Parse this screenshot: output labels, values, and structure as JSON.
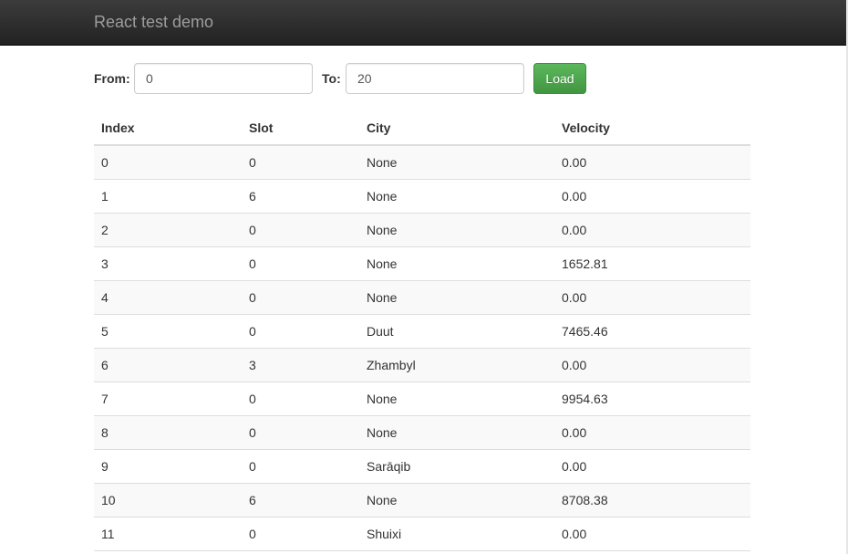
{
  "navbar": {
    "brand": "React test demo"
  },
  "form": {
    "from_label": "From:",
    "from_value": "0",
    "to_label": "To:",
    "to_value": "20",
    "load_label": "Load"
  },
  "table": {
    "headers": [
      "Index",
      "Slot",
      "City",
      "Velocity"
    ],
    "rows": [
      [
        "0",
        "0",
        "None",
        "0.00"
      ],
      [
        "1",
        "6",
        "None",
        "0.00"
      ],
      [
        "2",
        "0",
        "None",
        "0.00"
      ],
      [
        "3",
        "0",
        "None",
        "1652.81"
      ],
      [
        "4",
        "0",
        "None",
        "0.00"
      ],
      [
        "5",
        "0",
        "Duut",
        "7465.46"
      ],
      [
        "6",
        "3",
        "Zhambyl",
        "0.00"
      ],
      [
        "7",
        "0",
        "None",
        "9954.63"
      ],
      [
        "8",
        "0",
        "None",
        "0.00"
      ],
      [
        "9",
        "0",
        "Sarāqib",
        "0.00"
      ],
      [
        "10",
        "6",
        "None",
        "8708.38"
      ],
      [
        "11",
        "0",
        "Shuixi",
        "0.00"
      ]
    ]
  },
  "colors": {
    "navbar_top": "#3c3c3c",
    "navbar_bottom": "#222222",
    "brand_text": "#9d9d9d",
    "success_button": "#5cb85c",
    "row_stripe": "#f9f9f9"
  }
}
